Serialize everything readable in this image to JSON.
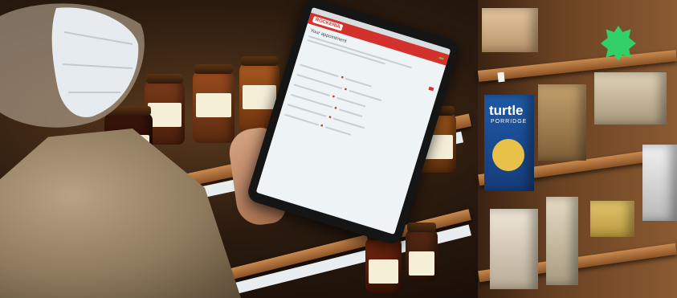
{
  "photo": {
    "tablet": {
      "app_logo": "ROCKERIA",
      "header_button": "",
      "content_title": "Your appointment",
      "action_button": ""
    },
    "packaging": {
      "cereal_box_brand": "turtle",
      "cereal_box_subtitle": "PORRIDGE"
    },
    "colors": {
      "app_accent": "#d3322c",
      "button_green": "#6bbf3b",
      "shelf_wood": "#c98a4e"
    }
  }
}
